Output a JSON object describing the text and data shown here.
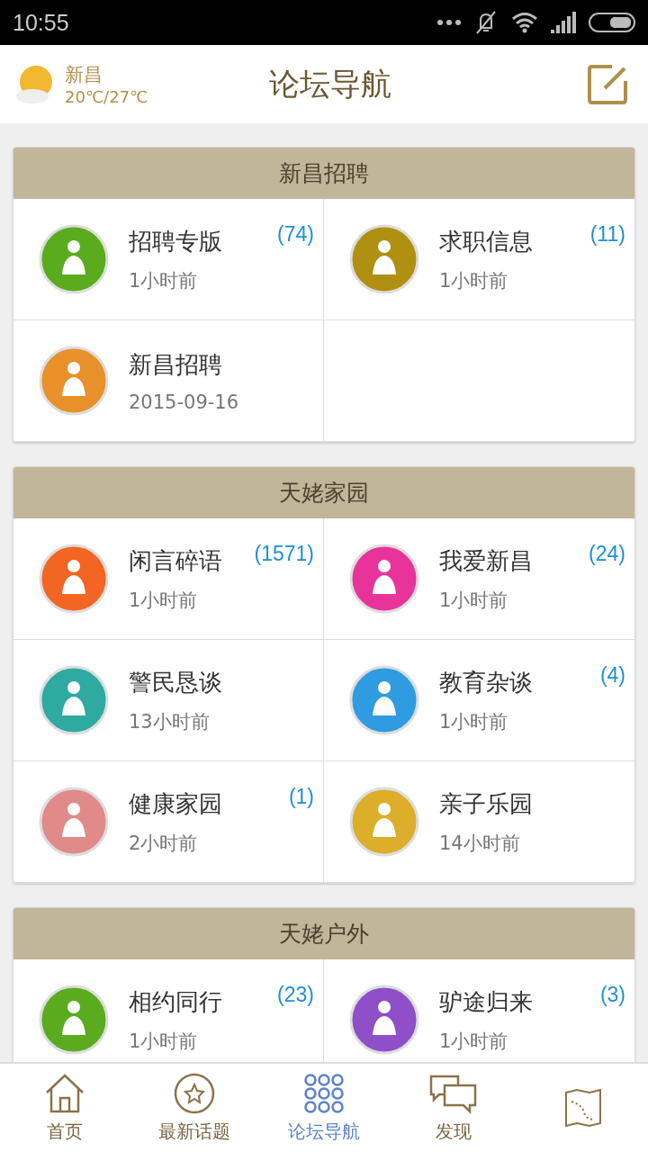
{
  "status_bar": {
    "time": "10:55"
  },
  "header": {
    "weather": {
      "city": "新昌",
      "temperature": "20℃/27℃"
    },
    "title": "论坛导航"
  },
  "sections": [
    {
      "title": "新昌招聘",
      "forums": [
        {
          "name": "招聘专版",
          "count": "(74)",
          "time": "1小时前",
          "color": "#5aac1e"
        },
        {
          "name": "求职信息",
          "count": "(11)",
          "time": "1小时前",
          "color": "#b09010"
        },
        {
          "name": "新昌招聘",
          "time": "2015-09-16",
          "color": "#e8902a"
        }
      ]
    },
    {
      "title": "天姥家园",
      "forums": [
        {
          "name": "闲言碎语",
          "count": "(1571)",
          "time": "1小时前",
          "color": "#f26522"
        },
        {
          "name": "我爱新昌",
          "count": "(24)",
          "time": "1小时前",
          "color": "#e8349a"
        },
        {
          "name": "警民恳谈",
          "time": "13小时前",
          "color": "#2eaaa0"
        },
        {
          "name": "教育杂谈",
          "count": "(4)",
          "time": "1小时前",
          "color": "#2f9be0"
        },
        {
          "name": "健康家园",
          "count": "(1)",
          "time": "2小时前",
          "color": "#e08a8a"
        },
        {
          "name": "亲子乐园",
          "time": "14小时前",
          "color": "#dcae2a"
        }
      ]
    },
    {
      "title": "天姥户外",
      "forums": [
        {
          "name": "相约同行",
          "count": "(23)",
          "time": "1小时前",
          "color": "#5aac1e"
        },
        {
          "name": "驴途归来",
          "count": "(3)",
          "time": "1小时前",
          "color": "#8e4fc8"
        }
      ]
    }
  ],
  "bottom_nav": [
    {
      "kind": "home",
      "label": "首页",
      "selected": false
    },
    {
      "kind": "star",
      "label": "最新话题",
      "selected": false
    },
    {
      "kind": "grid",
      "label": "论坛导航",
      "selected": true
    },
    {
      "kind": "chat",
      "label": "发现",
      "selected": false
    },
    {
      "kind": "map",
      "selected": false
    }
  ]
}
